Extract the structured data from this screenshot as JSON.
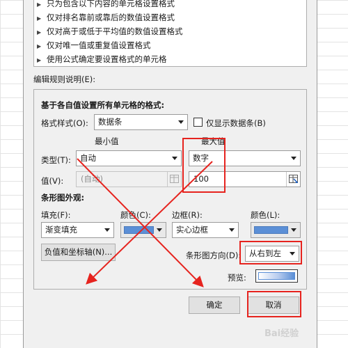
{
  "rule_types": [
    {
      "label": "只为包含以下内容的单元格设置格式"
    },
    {
      "label": "仅对排名靠前或靠后的数值设置格式"
    },
    {
      "label": "仅对高于或低于平均值的数值设置格式"
    },
    {
      "label": "仅对唯一值或重复值设置格式"
    },
    {
      "label": "使用公式确定要设置格式的单元格"
    }
  ],
  "edit_desc_label": "编辑规则说明(E):",
  "panel": {
    "heading": "基于各自值设置所有单元格的格式:",
    "format_style_label": "格式样式(O):",
    "format_style_value": "数据条",
    "show_bar_only_label": "仅显示数据条(B)",
    "min_header": "最小值",
    "max_header": "最大值",
    "type_label": "类型(T):",
    "min_type": "自动",
    "max_type": "数字",
    "value_label": "值(V):",
    "min_value": "(自动)",
    "max_value": "100",
    "bar_appearance": "条形图外观:",
    "fill_label": "填充(F):",
    "fill_value": "渐变填充",
    "color_label_1": "颜色(C):",
    "border_label": "边框(R):",
    "border_value": "实心边框",
    "color_label_2": "颜色(L):",
    "neg_axis_button": "负值和坐标轴(N)...",
    "direction_label": "条形图方向(D):",
    "direction_value": "从右到左",
    "preview_label": "预览:",
    "bar_color": "#5b8fd6"
  },
  "buttons": {
    "ok": "确定",
    "cancel": "取消"
  },
  "watermark": "Bai经验",
  "annotation_color": "#e6231e"
}
